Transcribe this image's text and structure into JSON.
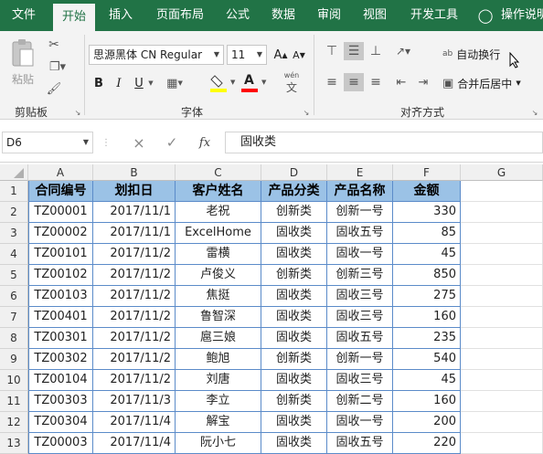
{
  "tabs": [
    "文件",
    "开始",
    "插入",
    "页面布局",
    "公式",
    "数据",
    "审阅",
    "视图",
    "开发工具"
  ],
  "help_label": "操作说明",
  "clipboard": {
    "paste": "粘贴",
    "group": "剪贴板"
  },
  "font": {
    "name": "思源黑体 CN Regular",
    "size": "11",
    "group": "字体",
    "bold": "B",
    "italic": "I",
    "underline": "U",
    "grow": "A",
    "shrink": "A",
    "color_letter": "A",
    "wen": "wén",
    "wen_char": "文"
  },
  "alignment": {
    "wrap": "自动换行",
    "merge": "合并后居中",
    "group": "对齐方式",
    "wrap_icon": "ab"
  },
  "formula_bar": {
    "name_box": "D6",
    "cancel": "×",
    "enter": "✓",
    "fx": "fx",
    "content": "固收类"
  },
  "columns": [
    "A",
    "B",
    "C",
    "D",
    "E",
    "F",
    "G"
  ],
  "header": [
    "合同编号",
    "划扣日",
    "客户姓名",
    "产品分类",
    "产品名称",
    "金额"
  ],
  "rows": [
    [
      "TZ00001",
      "2017/11/1",
      "老祝",
      "创新类",
      "创新一号",
      "330"
    ],
    [
      "TZ00002",
      "2017/11/1",
      "ExcelHome",
      "固收类",
      "固收五号",
      "85"
    ],
    [
      "TZ00101",
      "2017/11/2",
      "雷横",
      "固收类",
      "固收一号",
      "45"
    ],
    [
      "TZ00102",
      "2017/11/2",
      "卢俊义",
      "创新类",
      "创新三号",
      "850"
    ],
    [
      "TZ00103",
      "2017/11/2",
      "焦挺",
      "固收类",
      "固收三号",
      "275"
    ],
    [
      "TZ00401",
      "2017/11/2",
      "鲁智深",
      "固收类",
      "固收三号",
      "160"
    ],
    [
      "TZ00301",
      "2017/11/2",
      "扈三娘",
      "固收类",
      "固收五号",
      "235"
    ],
    [
      "TZ00302",
      "2017/11/2",
      "鲍旭",
      "创新类",
      "创新一号",
      "540"
    ],
    [
      "TZ00104",
      "2017/11/2",
      "刘唐",
      "固收类",
      "固收三号",
      "45"
    ],
    [
      "TZ00303",
      "2017/11/3",
      "李立",
      "创新类",
      "创新二号",
      "160"
    ],
    [
      "TZ00304",
      "2017/11/4",
      "解宝",
      "固收类",
      "固收一号",
      "200"
    ],
    [
      "TZ00003",
      "2017/11/4",
      "阮小七",
      "固收类",
      "固收五号",
      "220"
    ]
  ],
  "row_numbers": [
    "1",
    "2",
    "3",
    "4",
    "5",
    "6",
    "7",
    "8",
    "9",
    "10",
    "11",
    "12",
    "13"
  ],
  "colors": {
    "excel_green": "#217346",
    "header_fill": "#9bc2e6",
    "table_border": "#5b8bc9"
  }
}
